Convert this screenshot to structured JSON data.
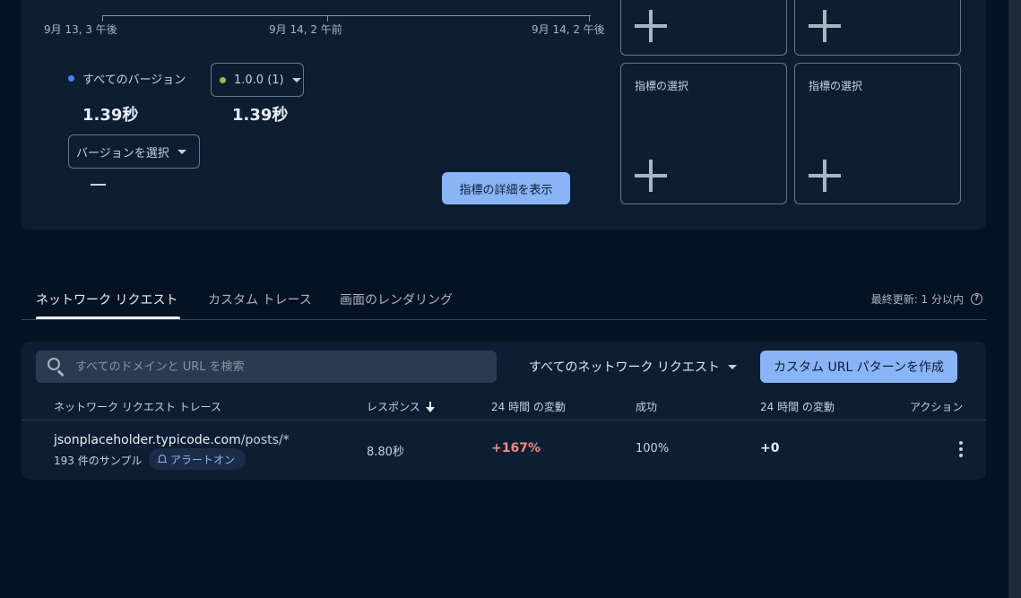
{
  "chart": {
    "x_ticks": [
      "9月 13, 3 午後",
      "9月 14, 2 午前",
      "9月 14, 2 午後"
    ],
    "legend": [
      {
        "label": "すべてのバージョン",
        "value": "1.39秒",
        "color": "#4285f4"
      },
      {
        "label": "1.0.0 (1)",
        "value": "1.39秒",
        "color": "#8bc34a"
      }
    ],
    "select_version_label": "バージョンを選択",
    "empty_value": "—",
    "detail_button_label": "指標の詳細を表示"
  },
  "metric_boxes": {
    "label": "指標の選択",
    "add_icon": "plus-icon"
  },
  "tabs": {
    "items": [
      "ネットワーク リクエスト",
      "カスタム トレース",
      "画面のレンダリング"
    ],
    "active_index": 0,
    "last_updated": "最終更新: 1 分以内",
    "help_icon": "help-icon"
  },
  "table": {
    "search_placeholder": "すべてのドメインと URL を検索",
    "filter_label": "すべてのネットワーク リクエスト",
    "create_button_label": "カスタム URL パターンを作成",
    "columns": [
      "ネットワーク リクエスト トレース",
      "レスポンス",
      "24 時間 の変動",
      "成功",
      "24 時間 の変動",
      "アクション"
    ],
    "rows": [
      {
        "host": "jsonplaceholder.typicode.com",
        "path": "/posts/*",
        "samples": "193 件のサンプル",
        "alert": "アラートオン",
        "response": "8.80秒",
        "response_change": "+167%",
        "success": "100%",
        "success_change": "+0"
      }
    ]
  },
  "colors": {
    "background": "#051221",
    "card": "#0d1e33",
    "accent": "#8ab4f8",
    "increase": "#f28b82"
  }
}
